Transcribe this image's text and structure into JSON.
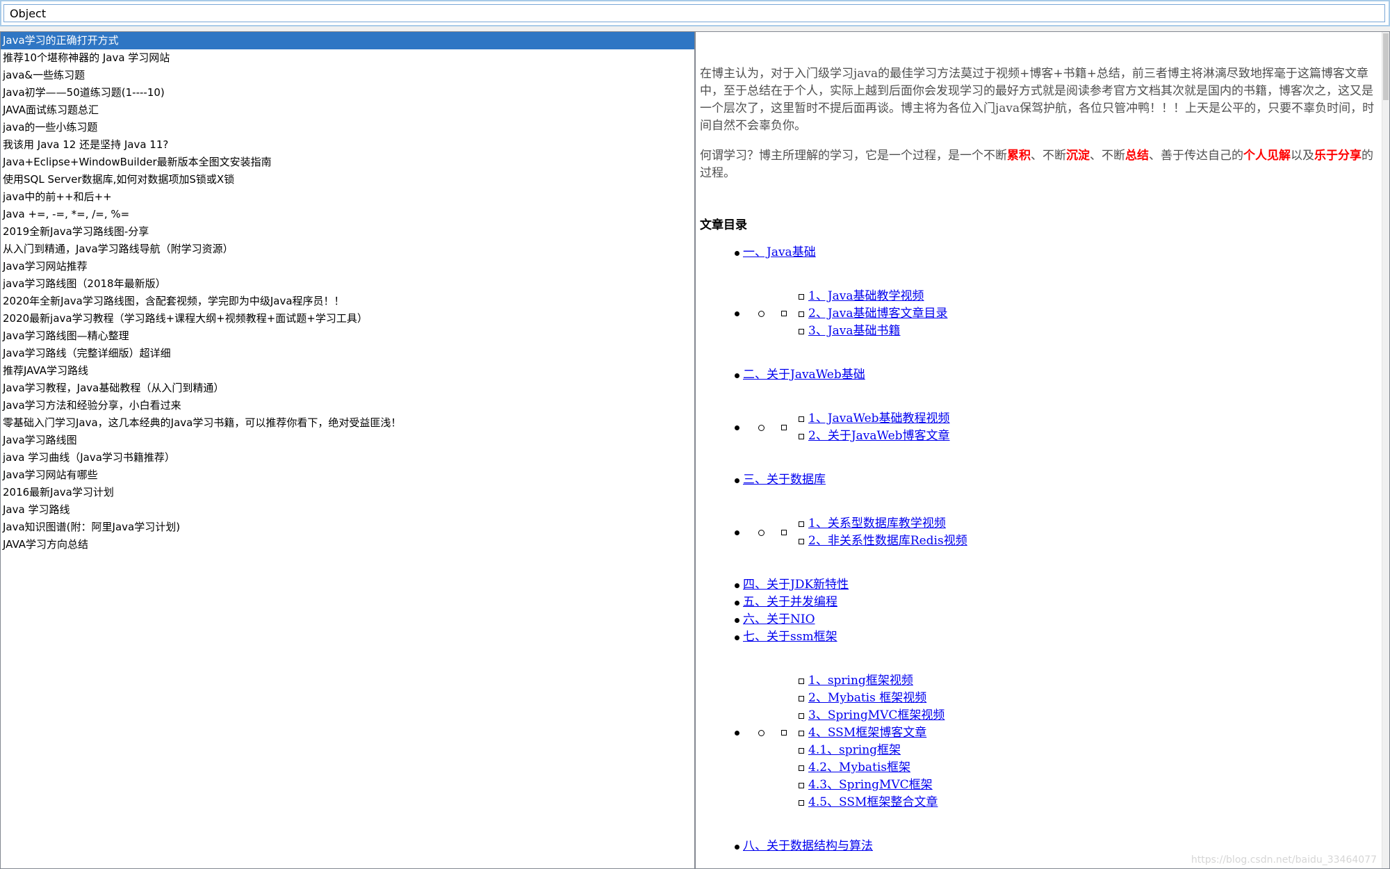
{
  "search": {
    "value": "Object"
  },
  "left": {
    "selected_index": 0,
    "items": [
      "Java学习的正确打开方式",
      "推荐10个堪称神器的 Java 学习网站",
      "java&一些练习题",
      "Java初学——50道练习题(1----10)",
      "JAVA面试练习题总汇",
      "java的一些小练习题",
      "我该用 Java 12 还是坚持 Java 11?",
      "Java+Eclipse+WindowBuilder最新版本全图文安装指南",
      "使用SQL Server数据库,如何对数据项加S锁或X锁",
      "java中的前++和后++",
      "Java +=, -=, *=, /=, %=",
      "2019全新Java学习路线图-分享",
      "从入门到精通，Java学习路线导航（附学习资源）",
      "Java学习网站推荐",
      "java学习路线图（2018年最新版）",
      "2020年全新Java学习路线图，含配套视频，学完即为中级Java程序员！！",
      "2020最新java学习教程（学习路线+课程大纲+视频教程+面试题+学习工具）",
      "Java学习路线图—精心整理",
      "Java学习路线（完整详细版）超详细",
      "推荐JAVA学习路线",
      "Java学习教程，Java基础教程（从入门到精通）",
      "Java学习方法和经验分享，小白看过来",
      "零基础入门学习Java，这几本经典的Java学习书籍，可以推荐你看下，绝对受益匪浅！",
      "Java学习路线图",
      "java 学习曲线（Java学习书籍推荐）",
      "Java学习网站有哪些",
      "2016最新Java学习计划",
      "Java 学习路线",
      "Java知识图谱(附：阿里Java学习计划)",
      "JAVA学习方向总结"
    ]
  },
  "right": {
    "para1": "在博主认为，对于入门级学习java的最佳学习方法莫过于视频+博客+书籍+总结，前三者博主将淋漓尽致地挥毫于这篇博客文章中，至于总结在于个人，实际上越到后面你会发现学习的最好方式就是阅读参考官方文档其次就是国内的书籍，博客次之，这又是一个层次了，这里暂时不提后面再谈。博主将为各位入门java保驾护航，各位只管冲鸭！！！上天是公平的，只要不辜负时间，时间自然不会辜负你。",
    "para2": {
      "t1": "何谓学习？博主所理解的学习，它是一个过程，是一个不断",
      "h1": "累积",
      "t2": "、不断",
      "h2": "沉淀",
      "t3": "、不断",
      "h3": "总结",
      "t4": "、善于传达自己的",
      "h4": "个人见解",
      "t5": "以及",
      "h5": "乐于分享",
      "t6": "的过程。"
    },
    "toc_heading": "文章目录",
    "toc": {
      "s1": "一、Java基础",
      "s1_sub": [
        "1、Java基础教学视频",
        "2、Java基础博客文章目录",
        "3、Java基础书籍"
      ],
      "s2": "二、关于JavaWeb基础",
      "s2_sub": [
        "1、JavaWeb基础教程视频",
        "2、关于JavaWeb博客文章"
      ],
      "s3": "三、关于数据库",
      "s3_sub": [
        "1、关系型数据库教学视频",
        "2、非关系性数据库Redis视频"
      ],
      "s4": "四、关于JDK新特性",
      "s5": "五、关于并发编程",
      "s6": "六、关于NIO",
      "s7": "七、关于ssm框架",
      "s7_sub": [
        "1、spring框架视频",
        "2、Mybatis 框架视频",
        "3、SpringMVC框架视频",
        "4、SSM框架博客文章",
        "4.1、spring框架",
        "4.2、Mybatis框架",
        "4.3、SpringMVC框架",
        "4.5、SSM框架整合文章"
      ],
      "s8": "八、关于数据结构与算法"
    },
    "watermark": "https://blog.csdn.net/baidu_33464077"
  },
  "colors": {
    "selection": "#2f76c4",
    "link": "#0000ee",
    "highlight": "#ff0000",
    "body_text": "#4f4f4f"
  }
}
